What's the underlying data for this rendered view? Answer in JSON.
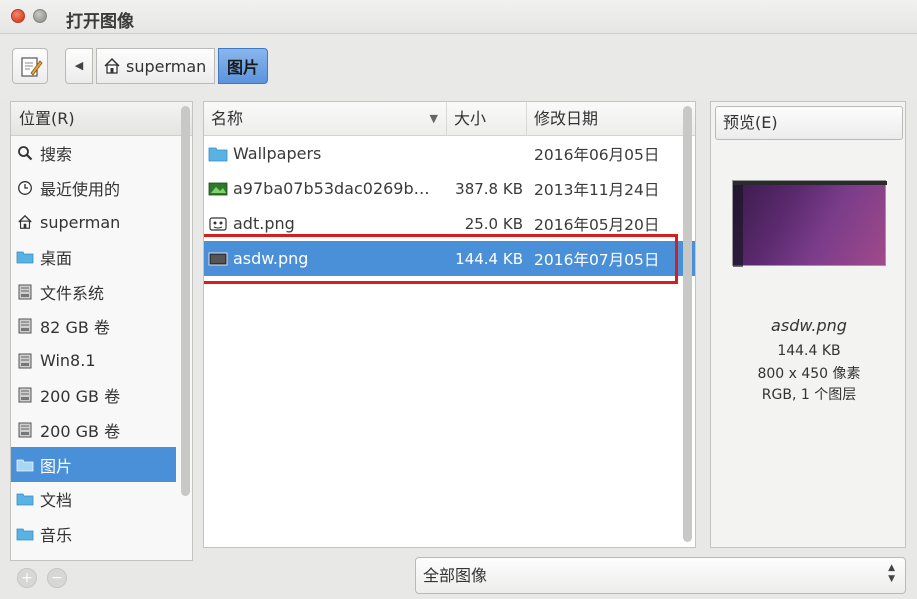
{
  "window": {
    "title": "打开图像"
  },
  "toolbar": {
    "path": [
      {
        "label": "superman",
        "icon": "home-icon"
      },
      {
        "label": "图片"
      }
    ]
  },
  "places": {
    "header": "位置(R)",
    "items": [
      {
        "label": "搜索",
        "icon": "search-icon"
      },
      {
        "label": "最近使用的",
        "icon": "recent-icon"
      },
      {
        "label": "superman",
        "icon": "home-icon"
      },
      {
        "label": "桌面",
        "icon": "folder-icon"
      },
      {
        "label": "文件系统",
        "icon": "drive-icon"
      },
      {
        "label": "82 GB 卷",
        "icon": "drive-icon"
      },
      {
        "label": "Win8.1",
        "icon": "drive-icon"
      },
      {
        "label": "200 GB 卷",
        "icon": "drive-icon"
      },
      {
        "label": "200 GB 卷",
        "icon": "drive-icon"
      },
      {
        "label": "图片",
        "icon": "folder-icon",
        "selected": true
      },
      {
        "label": "文档",
        "icon": "folder-icon"
      },
      {
        "label": "音乐",
        "icon": "folder-icon"
      }
    ]
  },
  "files": {
    "columns": {
      "name": "名称",
      "size": "大小",
      "modified": "修改日期"
    },
    "rows": [
      {
        "name": "Wallpapers",
        "size": "",
        "modified": "2016年06月05日",
        "icon": "folder-icon"
      },
      {
        "name": "a97ba07b53dac0269b…",
        "size": "387.8 KB",
        "modified": "2013年11月24日",
        "icon": "image-icon"
      },
      {
        "name": "adt.png",
        "size": "25.0 KB",
        "modified": "2016年05月20日",
        "icon": "image-icon"
      },
      {
        "name": "asdw.png",
        "size": "144.4 KB",
        "modified": "2016年07月05日",
        "icon": "image-icon",
        "selected": true
      }
    ]
  },
  "preview": {
    "toggle_label": "预览(E)",
    "file_name": "asdw.png",
    "file_size": "144.4 KB",
    "dimensions": "800 x 450 像素",
    "color_info": "RGB, 1 个图层"
  },
  "filter": {
    "selected": "全部图像"
  },
  "colors": {
    "selection": "#4a90d9",
    "highlight_box": "#d41f1f"
  }
}
